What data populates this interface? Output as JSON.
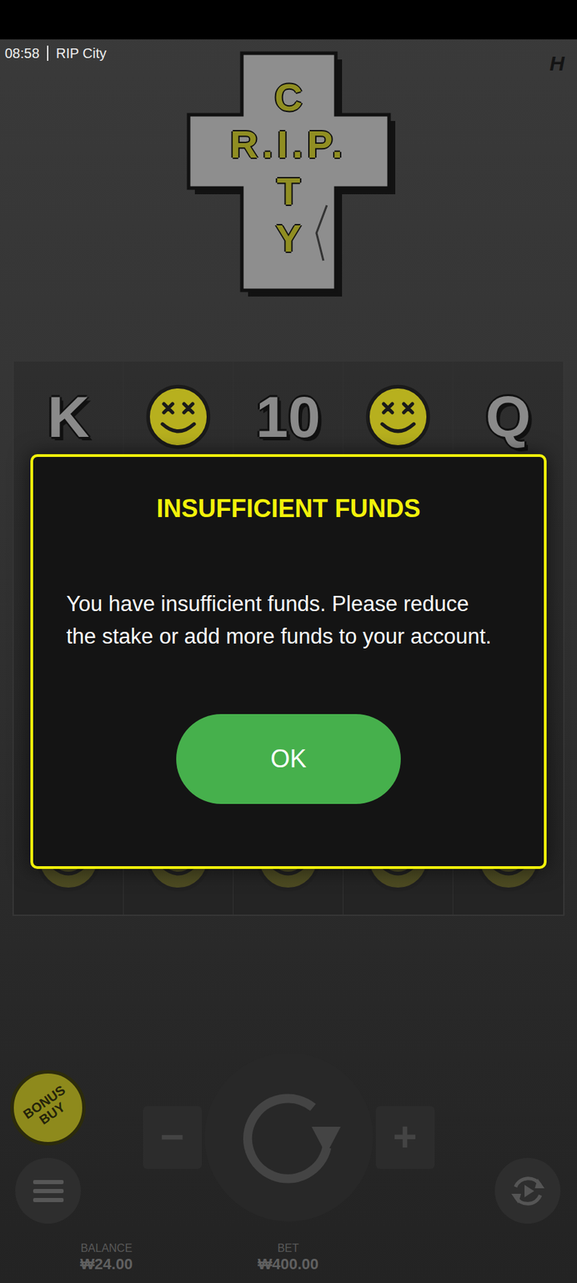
{
  "status_bar": {
    "time": "08:58",
    "title": "RIP City"
  },
  "brand_mark": "H",
  "logo": {
    "column_top": "C",
    "row": "R.I.P.",
    "column_bottom": "TY"
  },
  "reels": {
    "rows": [
      [
        {
          "kind": "letter",
          "text": "K",
          "dimmed": false
        },
        {
          "kind": "icon",
          "dimmed": false
        },
        {
          "kind": "letter",
          "text": "10",
          "dimmed": false
        },
        {
          "kind": "icon",
          "dimmed": false
        },
        {
          "kind": "letter",
          "text": "Q",
          "dimmed": false
        }
      ],
      [
        {
          "kind": "icon",
          "dimmed": true
        },
        {
          "kind": "icon",
          "dimmed": true
        },
        {
          "kind": "icon",
          "dimmed": true
        },
        {
          "kind": "icon",
          "dimmed": true
        },
        {
          "kind": "icon",
          "dimmed": true
        }
      ],
      [
        {
          "kind": "icon",
          "dimmed": true
        },
        {
          "kind": "icon",
          "dimmed": true
        },
        {
          "kind": "icon",
          "dimmed": true
        },
        {
          "kind": "icon",
          "dimmed": true
        },
        {
          "kind": "icon",
          "dimmed": true
        }
      ],
      [
        {
          "kind": "icon",
          "dimmed": true
        },
        {
          "kind": "icon",
          "dimmed": true
        },
        {
          "kind": "icon",
          "dimmed": true
        },
        {
          "kind": "icon",
          "dimmed": true
        },
        {
          "kind": "icon",
          "dimmed": true
        }
      ],
      [
        {
          "kind": "icon",
          "dimmed": true
        },
        {
          "kind": "icon",
          "dimmed": true
        },
        {
          "kind": "icon",
          "dimmed": true
        },
        {
          "kind": "icon",
          "dimmed": true
        },
        {
          "kind": "icon",
          "dimmed": true
        }
      ]
    ]
  },
  "controls": {
    "bonus_buy": "BONUS BUY",
    "decrease": "−",
    "increase": "+"
  },
  "footer": {
    "balance_label": "BALANCE",
    "balance": "₩24.00",
    "bet_label": "BET",
    "bet": "₩400.00"
  },
  "dialog": {
    "title": "INSUFFICIENT FUNDS",
    "message": "You have insufficient funds. Please reduce the stake or add more funds to your account.",
    "buttons": [
      "OK"
    ]
  }
}
